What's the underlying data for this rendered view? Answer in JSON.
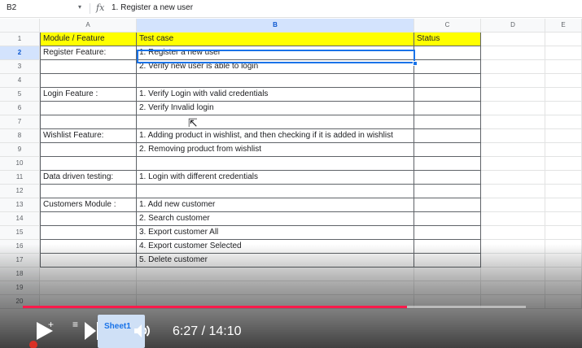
{
  "formula_bar": {
    "cell_ref": "B2",
    "dropdown": "▾",
    "fx": "fx",
    "value": "1. Register a new user"
  },
  "columns": [
    "A",
    "B",
    "C",
    "D",
    "E"
  ],
  "rows": [
    {
      "num": "1",
      "a": "Module / Feature",
      "b": "Test case",
      "c": "Status"
    },
    {
      "num": "2",
      "a": "Register Feature:",
      "b": "1. Register a new user",
      "c": ""
    },
    {
      "num": "3",
      "a": "",
      "b": "2. Verify new user is able to login",
      "c": ""
    },
    {
      "num": "4",
      "a": "",
      "b": "",
      "c": ""
    },
    {
      "num": "5",
      "a": "Login Feature :",
      "b": "1. Verify Login with valid credentials",
      "c": ""
    },
    {
      "num": "6",
      "a": "",
      "b": "2. Verify Invalid login",
      "c": ""
    },
    {
      "num": "7",
      "a": "",
      "b": "",
      "c": ""
    },
    {
      "num": "8",
      "a": "Wishlist Feature:",
      "b": "1. Adding product in wishlist, and then checking if it is added in wishlist",
      "c": ""
    },
    {
      "num": "9",
      "a": "",
      "b": "2. Removing product from wishlist",
      "c": ""
    },
    {
      "num": "10",
      "a": "",
      "b": "",
      "c": ""
    },
    {
      "num": "11",
      "a": "Data driven testing:",
      "b": "1. Login with different credentials",
      "c": ""
    },
    {
      "num": "12",
      "a": "",
      "b": "",
      "c": ""
    },
    {
      "num": "13",
      "a": "Customers Module :",
      "b": "1. Add new customer",
      "c": ""
    },
    {
      "num": "14",
      "a": "",
      "b": "2. Search customer",
      "c": ""
    },
    {
      "num": "15",
      "a": "",
      "b": "3. Export customer All",
      "c": ""
    },
    {
      "num": "16",
      "a": "",
      "b": "4. Export customer Selected",
      "c": ""
    },
    {
      "num": "17",
      "a": "",
      "b": "5. Delete customer",
      "c": ""
    },
    {
      "num": "18",
      "a": "",
      "b": "",
      "c": ""
    },
    {
      "num": "19",
      "a": "",
      "b": "",
      "c": ""
    },
    {
      "num": "20",
      "a": "",
      "b": "",
      "c": ""
    }
  ],
  "sheet_tab": "Sheet1",
  "video": {
    "time": "6:27 / 14:10",
    "progress": 0.764
  },
  "colors": {
    "header_fill": "#ffff00",
    "selection": "#1a73e8",
    "progress": "#ff1a4b"
  }
}
